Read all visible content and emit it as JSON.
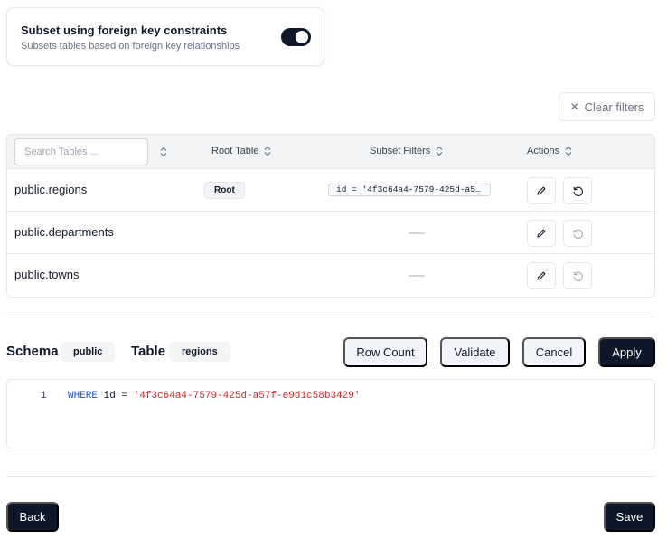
{
  "fk_setting": {
    "title": "Subset using foreign key constraints",
    "description": "Subsets tables based on foreign key relationships",
    "enabled": true
  },
  "clear_filters_label": "Clear filters",
  "table": {
    "search_placeholder": "Search Tables ...",
    "columns": {
      "root_table": "Root Table",
      "subset_filters": "Subset Filters",
      "actions": "Actions"
    },
    "rows": [
      {
        "name": "public.regions",
        "root_badge": "Root",
        "filter": "id = '4f3c64a4-7579-425d-a57f-e9d1c58b3429'"
      },
      {
        "name": "public.departments"
      },
      {
        "name": "public.towns"
      }
    ]
  },
  "editor_header": {
    "schema_label": "Schema",
    "schema_value": "public",
    "table_label": "Table",
    "table_value": "regions"
  },
  "buttons": {
    "row_count": "Row Count",
    "validate": "Validate",
    "cancel": "Cancel",
    "apply": "Apply",
    "back": "Back",
    "save": "Save"
  },
  "editor": {
    "line_number": "1",
    "keyword": "WHERE",
    "column": " id = ",
    "value": "'4f3c64a4-7579-425d-a57f-e9d1c58b3429'"
  },
  "colors": {
    "primary_dark": "#0f172a",
    "keyword_blue": "#1d4ed8",
    "string_red": "#dc2626"
  }
}
